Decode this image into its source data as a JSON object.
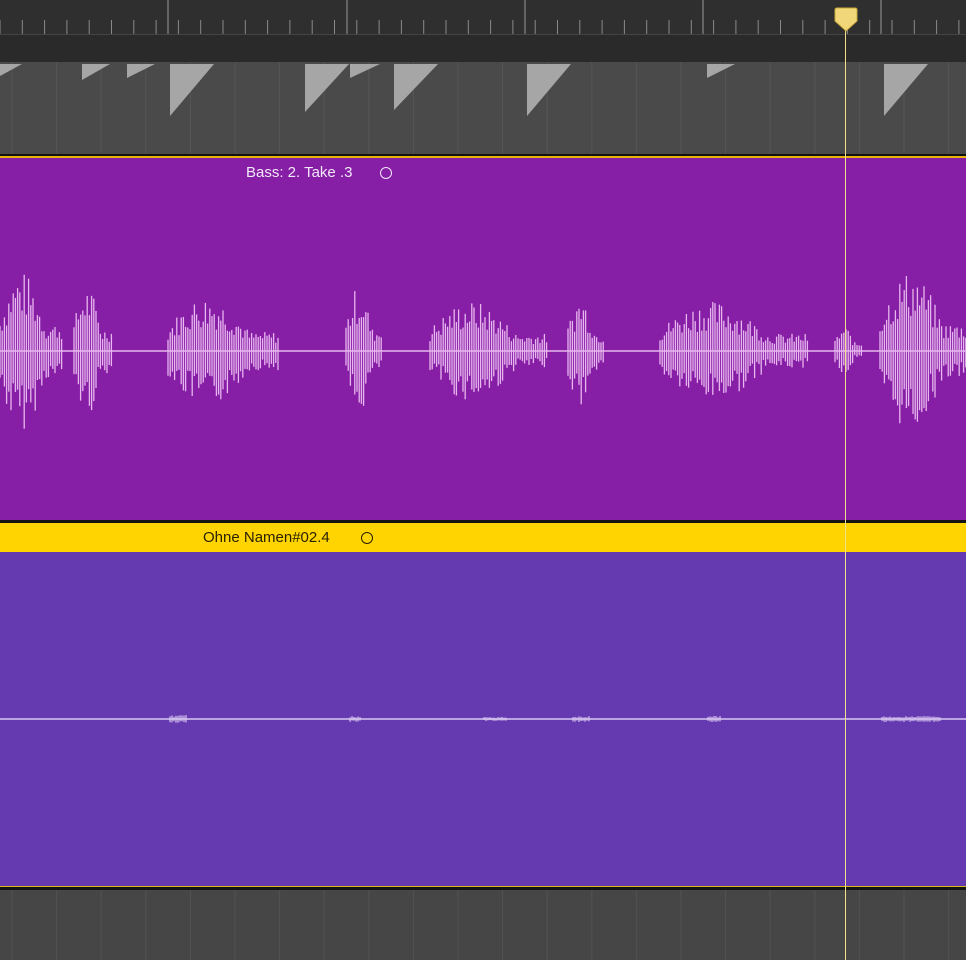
{
  "tracks": {
    "bass": {
      "region_name": "Bass: 2. Take .3",
      "color": "#861ea6",
      "waveform_color": "#e7b6ee",
      "loop_icon": "loop-circle-icon"
    },
    "ohne": {
      "region_name": "Ohne Namen#02.4",
      "color": "#653ab0",
      "header_color": "#ffd400",
      "waveform_color": "#d8c8f0",
      "loop_icon": "loop-circle-icon"
    }
  },
  "playhead": {
    "icon": "playhead-handle-icon",
    "color": "#f2e08a"
  },
  "transient_marker_color": "#a6a6a6"
}
